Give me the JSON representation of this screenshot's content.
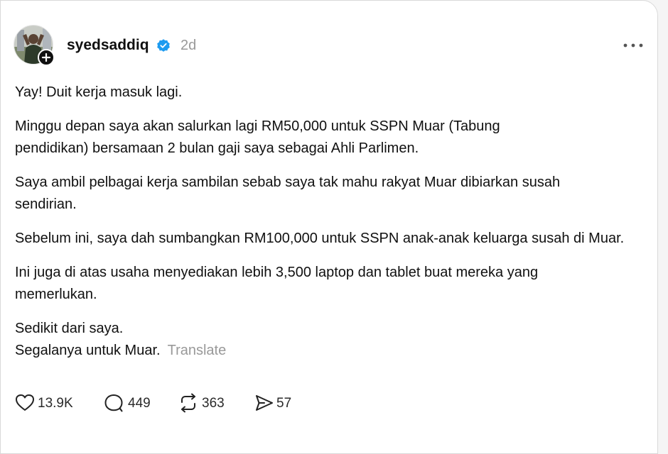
{
  "post": {
    "username": "syedsaddiq",
    "time": "2d",
    "paragraphs": [
      "Yay! Duit kerja masuk lagi.",
      "Minggu depan saya akan salurkan lagi RM50,000 untuk SSPN Muar (Tabung pendidikan) bersamaan 2 bulan gaji saya sebagai Ahli Parlimen.",
      "Saya ambil pelbagai kerja sambilan sebab saya tak mahu rakyat Muar dibiarkan susah sendirian.",
      "Sebelum ini, saya dah sumbangkan RM100,000 untuk SSPN anak-anak keluarga susah di Muar.",
      "Ini juga di atas usaha menyediakan lebih 3,500 laptop dan tablet buat mereka yang memerlukan."
    ],
    "closing_line1": "Sedikit dari saya.",
    "closing_line2": "Segalanya untuk Muar.",
    "translate_label": "Translate"
  },
  "actions": {
    "likes": "13.9K",
    "comments": "449",
    "reposts": "363",
    "shares": "57"
  },
  "icons": {
    "verified": "verified-badge-icon",
    "follow": "plus-icon",
    "more": "more-icon",
    "like": "heart-icon",
    "comment": "comment-icon",
    "repost": "repost-icon",
    "share": "share-icon"
  },
  "colors": {
    "verified_blue": "#1d9bf0",
    "muted_text": "#999999"
  }
}
